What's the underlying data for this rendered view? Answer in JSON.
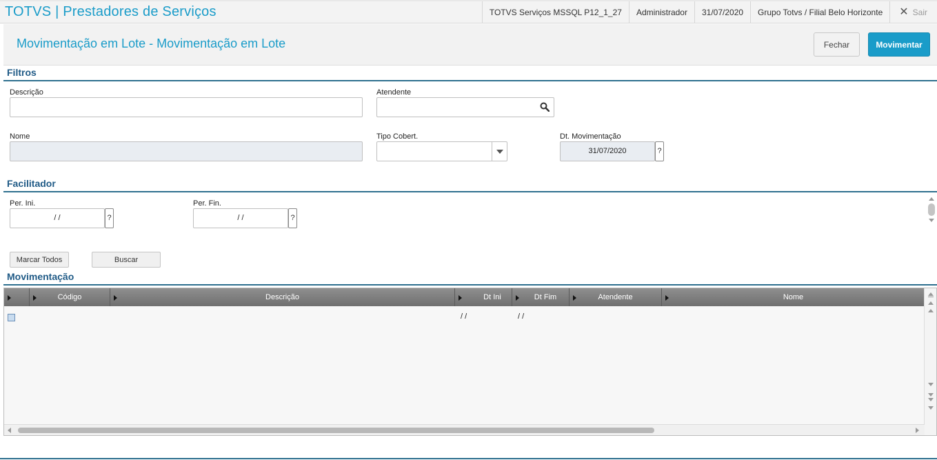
{
  "topbar": {
    "title": "TOTVS | Prestadores de Serviços",
    "environment": "TOTVS Serviços MSSQL P12_1_27",
    "user": "Administrador",
    "date": "31/07/2020",
    "company": "Grupo Totvs / Filial Belo Horizonte",
    "exit_label": "Sair"
  },
  "header": {
    "title": "Movimentação em Lote - Movimentação em Lote",
    "close_label": "Fechar",
    "primary_label": "Movimentar",
    "accent_color": "#1a9cc9"
  },
  "filtros": {
    "title": "Filtros",
    "descricao": {
      "label": "Descrição",
      "value": ""
    },
    "atendente": {
      "label": "Atendente",
      "value": "",
      "icon": "search-icon"
    },
    "nome": {
      "label": "Nome",
      "value": ""
    },
    "tipo_cobert": {
      "label": "Tipo Cobert.",
      "value": ""
    },
    "dt_movimentacao": {
      "label": "Dt. Movimentação",
      "value": "31/07/2020",
      "help": "?"
    }
  },
  "facilitador": {
    "title": "Facilitador",
    "per_ini": {
      "label": "Per. Ini.",
      "value": "/ /",
      "help": "?"
    },
    "per_fin": {
      "label": "Per. Fin.",
      "value": "/ /",
      "help": "?"
    },
    "mark_all_label": "Marcar Todos",
    "search_label": "Buscar"
  },
  "movimentacao": {
    "title": "Movimentação",
    "columns": [
      "Código",
      "Descrição",
      "Dt Ini",
      "Dt Fim",
      "Atendente",
      "Nome"
    ],
    "rows": [
      {
        "codigo": "",
        "descricao": "",
        "dt_ini": "/ /",
        "dt_fim": "/ /",
        "atendente": "",
        "nome": ""
      }
    ]
  }
}
